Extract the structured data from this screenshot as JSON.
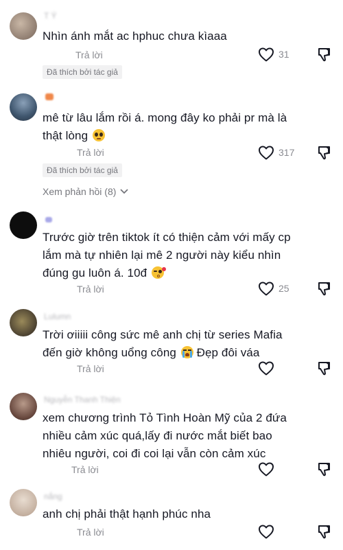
{
  "comments": [
    {
      "username": "T Ý",
      "text": "Nhìn ánh mắt ac hphuc chưa kìaaa",
      "reply_label": "Trả lời",
      "likes": "31",
      "author_badge": "Đã thích bởi tác giả"
    },
    {
      "username": "",
      "text": "mê từ lâu lắm rồi á. mong đây ko phải pr mà là thật lòng",
      "emoji": "pleading-face",
      "reply_label": "Trả lời",
      "likes": "317",
      "author_badge": "Đã thích bởi tác giả",
      "view_replies": "Xem phản hồi (8)"
    },
    {
      "username": "",
      "text": "Trước giờ trên tiktok ít có thiện cảm với mấy cp lắm mà tự nhiên lại mê 2 người này kiểu nhìn đúng gu luôn á. 10đ",
      "emoji": "kissing-face",
      "reply_label": "Trả lời",
      "likes": "25"
    },
    {
      "username": "Lulumn",
      "text": "Trời ơiiiii công sức mê anh chị từ series Mafia đến giờ không uổng công",
      "emoji": "crying-face",
      "text_suffix": "Đẹp đôi váa",
      "reply_label": "Trả lời"
    },
    {
      "username": "Nguyễn Thanh Thiện",
      "text": "xem chương trình Tỏ Tình Hoàn Mỹ của 2 đứa nhiều cảm xúc quá,lấy đi nước mắt biết bao nhiêu người, coi đi coi lại vẫn còn cảm xúc",
      "reply_label": "Trả lời"
    },
    {
      "username": "nắng",
      "text": "anh chị phải thật hạnh phúc nha",
      "reply_label": "Trả lời"
    }
  ],
  "colors": {
    "text": "#161823",
    "muted": "#8a8b91",
    "badge_bg": "#f1f1f2",
    "emoji_yellow": "#f7c234"
  },
  "icons": {
    "like": "heart-outline-icon",
    "dislike": "thumbs-down-icon",
    "view_replies_chevron": "chevron-down-icon"
  }
}
